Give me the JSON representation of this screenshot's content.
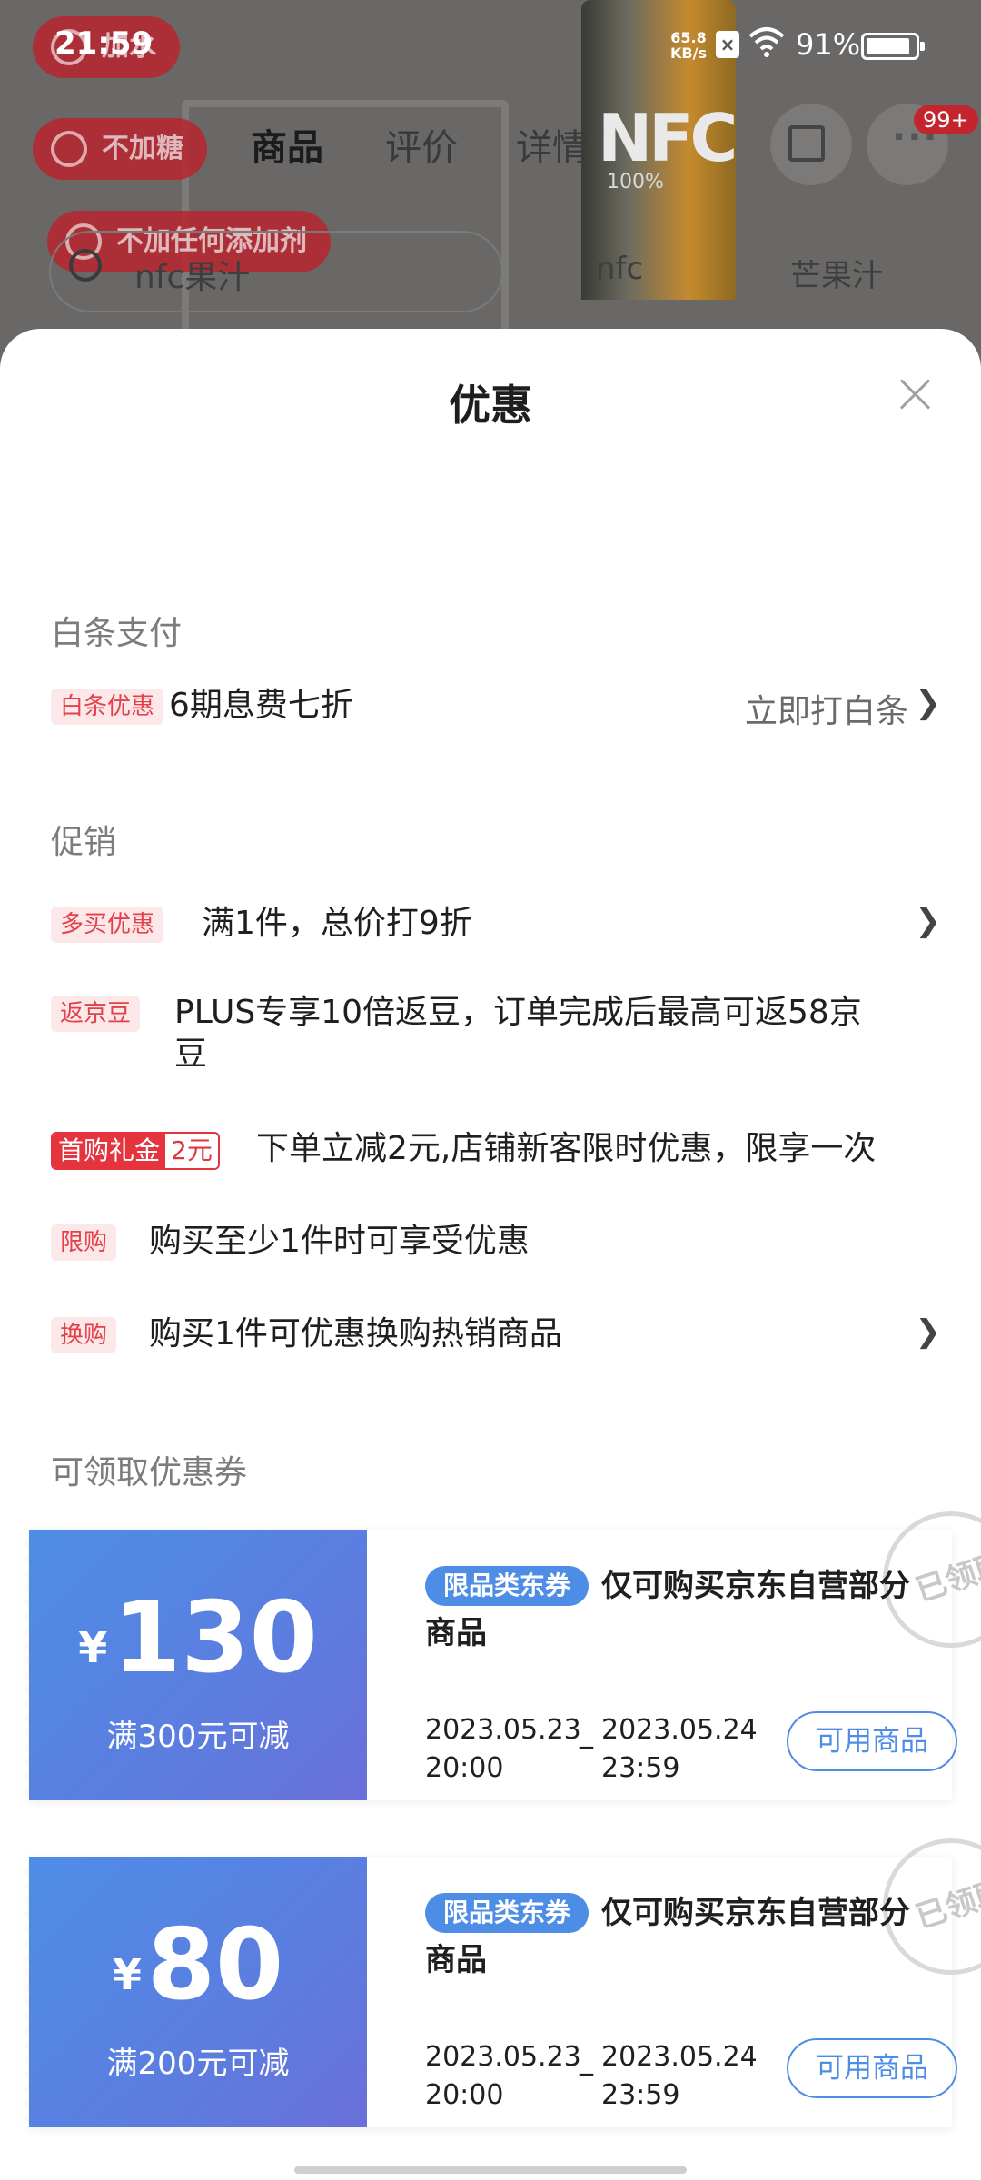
{
  "status_bar": {
    "time": "21:59",
    "net_speed_value": "65.8",
    "net_speed_unit": "KB/s",
    "battery_text": "91%",
    "battery_level": 0.91
  },
  "background": {
    "tags": [
      "加水",
      "不加糖",
      "不加任何添加剂"
    ],
    "tabs": [
      "商品",
      "评价",
      "详情"
    ],
    "product_logo": "NFC",
    "product_sub": "100%",
    "search_text": "nfc果汁",
    "chips": [
      "nfc",
      "芒果汁"
    ],
    "badge": "99+"
  },
  "sheet": {
    "title": "优惠",
    "baitiao": {
      "section_title": "白条支付",
      "tag": "白条优惠",
      "text": "6期息费七折",
      "action": "立即打白条"
    },
    "promo": {
      "section_title": "促销",
      "items": [
        {
          "tag": "多买优惠",
          "text": "满1件，总价打9折"
        },
        {
          "tag": "返京豆",
          "text_line1": "PLUS专享10倍返豆，订单完成后最高可返58京",
          "text_line2": "豆"
        },
        {
          "tag_main": "首购礼金",
          "tag_value": "2元",
          "text": "下单立减2元,店铺新客限时优惠，限享一次"
        },
        {
          "tag": "限购",
          "text": "购买至少1件时可享受优惠"
        },
        {
          "tag": "换购",
          "text": "购买1件可优惠换购热销商品"
        }
      ]
    },
    "coupons": {
      "section_title": "可领取优惠券",
      "items": [
        {
          "currency": "¥",
          "amount": "130",
          "condition": "满300元可减",
          "badge": "限品类东券",
          "desc": "仅可购买京东自营部分商品",
          "date_start": "2023.05.23",
          "time_start": "20:00",
          "date_sep": "_",
          "date_end": "2023.05.24",
          "time_end": "23:59",
          "button": "可用商品",
          "stamp": "已领取"
        },
        {
          "currency": "¥",
          "amount": "80",
          "condition": "满200元可减",
          "badge": "限品类东券",
          "desc": "仅可购买京东自营部分商品",
          "date_start": "2023.05.23",
          "time_start": "20:00",
          "date_sep": "_",
          "date_end": "2023.05.24",
          "time_end": "23:59",
          "button": "可用商品",
          "stamp": "已领取"
        }
      ]
    }
  },
  "colors": {
    "accent_red": "#e5343e",
    "coupon_blue": "#4e8de6",
    "coupon_purple": "#6a6fd9"
  },
  "icons": [
    "close-icon",
    "chevron-right-icon",
    "wifi-icon",
    "battery-icon",
    "search-icon",
    "share-icon",
    "more-icon"
  ]
}
